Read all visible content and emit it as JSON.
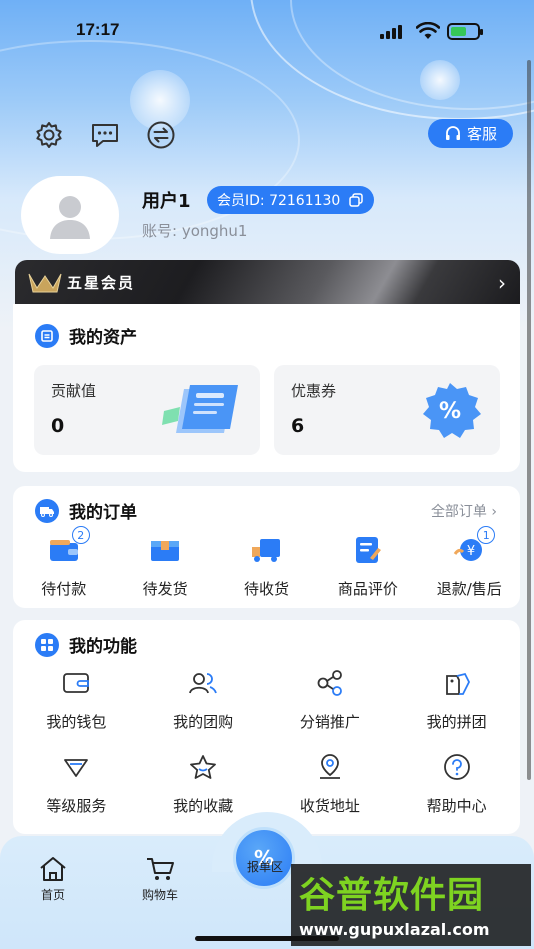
{
  "status_bar": {
    "time": "17:17"
  },
  "header": {
    "service_label": "客服"
  },
  "profile": {
    "username": "用户1",
    "member_id": "会员ID: 72161130",
    "account": "账号: yonghu1"
  },
  "vip": {
    "label": "五星会员"
  },
  "assets": {
    "title": "我的资产",
    "items": [
      {
        "name": "贡献值",
        "value": "0"
      },
      {
        "name": "优惠券",
        "value": "6"
      }
    ]
  },
  "orders": {
    "title": "我的订单",
    "all_label": "全部订单",
    "items": [
      {
        "label": "待付款",
        "badge": "2"
      },
      {
        "label": "待发货"
      },
      {
        "label": "待收货"
      },
      {
        "label": "商品评价"
      },
      {
        "label": "退款/售后",
        "badge": "1"
      }
    ]
  },
  "functions": {
    "title": "我的功能",
    "items": [
      {
        "label": "我的钱包",
        "icon": "wallet-icon"
      },
      {
        "label": "我的团购",
        "icon": "group-buy-icon"
      },
      {
        "label": "分销推广",
        "icon": "share-icon"
      },
      {
        "label": "我的拼团",
        "icon": "group-tag-icon"
      },
      {
        "label": "等级服务",
        "icon": "level-icon"
      },
      {
        "label": "我的收藏",
        "icon": "star-icon"
      },
      {
        "label": "收货地址",
        "icon": "location-icon"
      },
      {
        "label": "帮助中心",
        "icon": "help-icon"
      }
    ]
  },
  "tabbar": {
    "items": [
      {
        "label": "首页"
      },
      {
        "label": "购物车"
      },
      {
        "label": "报单区"
      }
    ]
  },
  "watermark": {
    "title": "谷普软件园",
    "url": "www.gupuxlazal.com"
  },
  "colors": {
    "accent": "#2b7cf6",
    "background": "#eef2f7"
  }
}
